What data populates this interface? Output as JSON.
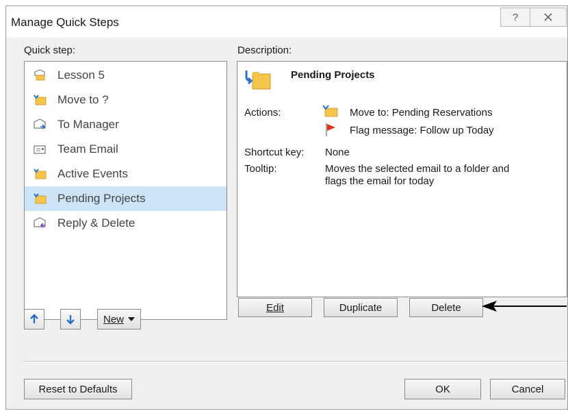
{
  "window": {
    "title": "Manage Quick Steps",
    "help_glyph": "?",
    "close_glyph": "X"
  },
  "labels": {
    "quick_step": "Quick step:",
    "description": "Description:"
  },
  "quick_steps": [
    {
      "label": "Lesson 5",
      "icon": "email-folder-icon",
      "selected": false
    },
    {
      "label": "Move to ?",
      "icon": "folder-move-icon",
      "selected": false
    },
    {
      "label": "To Manager",
      "icon": "email-forward-icon",
      "selected": false
    },
    {
      "label": "Team Email",
      "icon": "email-icon",
      "selected": false
    },
    {
      "label": "Active Events",
      "icon": "folder-move-icon",
      "selected": false
    },
    {
      "label": "Pending Projects",
      "icon": "folder-move-icon",
      "selected": true
    },
    {
      "label": "Reply & Delete",
      "icon": "reply-delete-icon",
      "selected": false
    }
  ],
  "description": {
    "name": "Pending Projects",
    "actions_label": "Actions:",
    "actions": [
      {
        "text": "Move to: Pending Reservations",
        "icon": "folder-move-icon"
      },
      {
        "text": "Flag message: Follow up Today",
        "icon": "red-flag-icon"
      }
    ],
    "shortcut_label": "Shortcut key:",
    "shortcut_value": "None",
    "tooltip_label": "Tooltip:",
    "tooltip_line1": "Moves the selected email to a folder and",
    "tooltip_line2": "flags the email for today"
  },
  "buttons": {
    "edit": "Edit",
    "duplicate": "Duplicate",
    "delete": "Delete",
    "new": "New",
    "reset": "Reset to Defaults",
    "ok": "OK",
    "cancel": "Cancel"
  },
  "colors": {
    "selection": "#cde4f7",
    "folder": "#f4c44b",
    "flag": "#e0361a",
    "arrow_blue": "#2a6fc9"
  }
}
